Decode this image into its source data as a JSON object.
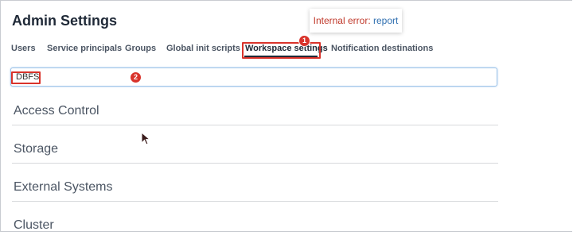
{
  "page": {
    "title": "Admin Settings"
  },
  "toast": {
    "error_text": "Internal error:",
    "link_text": "report"
  },
  "tabs": [
    {
      "label": "Users"
    },
    {
      "label": "Service principals"
    },
    {
      "label": "Groups"
    },
    {
      "label": "Global init scripts"
    },
    {
      "label": "Workspace settings",
      "active": true
    },
    {
      "label": "Notification destinations"
    }
  ],
  "search": {
    "value": "DBFS",
    "placeholder": ""
  },
  "sections": [
    {
      "label": "Access Control"
    },
    {
      "label": "Storage"
    },
    {
      "label": "External Systems"
    },
    {
      "label": "Cluster"
    }
  ],
  "annotations": [
    {
      "number": "1"
    },
    {
      "number": "2"
    }
  ],
  "colors": {
    "accent": "#d9332b",
    "error_text": "#c0392b",
    "link": "#2f6fb0",
    "input_border": "#9cc3e8"
  }
}
